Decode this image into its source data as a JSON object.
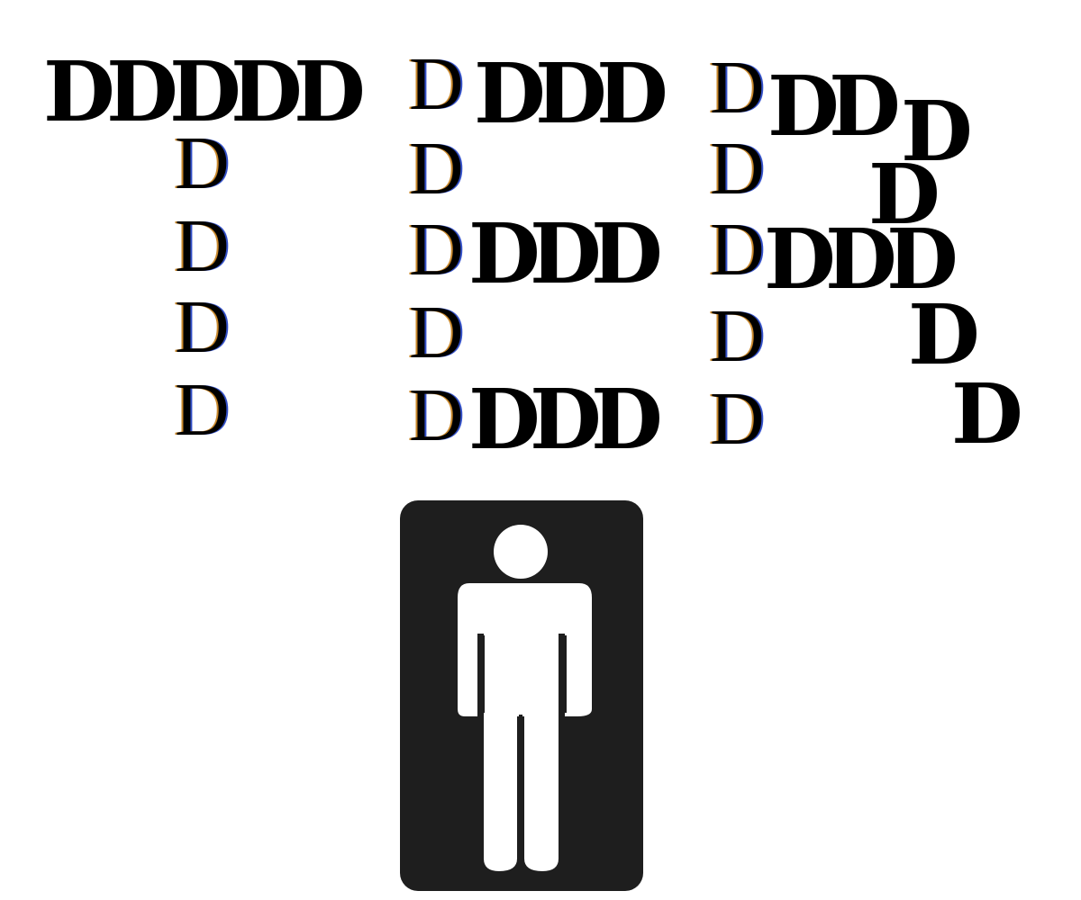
{
  "letters": {
    "glyph": "D",
    "shadow_colors": [
      "#c8872a",
      "#3552c9"
    ]
  },
  "sign": {
    "icon": "person-icon",
    "background_color": "#1e1e1e",
    "figure_color": "#ffffff"
  }
}
